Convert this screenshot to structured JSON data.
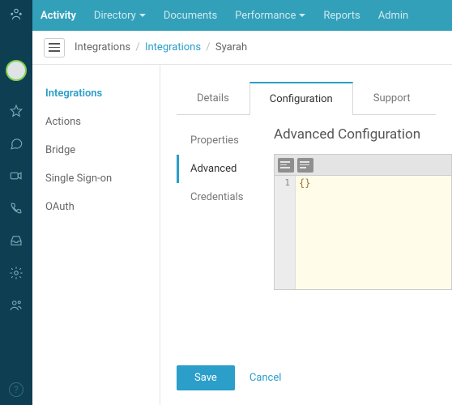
{
  "topnav": {
    "items": [
      {
        "label": "Activity",
        "active": true,
        "caret": false
      },
      {
        "label": "Directory",
        "active": false,
        "caret": true
      },
      {
        "label": "Documents",
        "active": false,
        "caret": false
      },
      {
        "label": "Performance",
        "active": false,
        "caret": true
      },
      {
        "label": "Reports",
        "active": false,
        "caret": false
      },
      {
        "label": "Admin",
        "active": false,
        "caret": false
      }
    ]
  },
  "breadcrumb": {
    "root": "Integrations",
    "link": "Integrations",
    "current": "Syarah"
  },
  "leftmenu": {
    "items": [
      {
        "label": "Integrations",
        "active": true
      },
      {
        "label": "Actions",
        "active": false
      },
      {
        "label": "Bridge",
        "active": false
      },
      {
        "label": "Single Sign-on",
        "active": false
      },
      {
        "label": "OAuth",
        "active": false
      }
    ]
  },
  "tabs": {
    "items": [
      {
        "label": "Details",
        "active": false
      },
      {
        "label": "Configuration",
        "active": true
      },
      {
        "label": "Support",
        "active": false
      }
    ]
  },
  "subtabs": {
    "items": [
      {
        "label": "Properties",
        "active": false
      },
      {
        "label": "Advanced",
        "active": true
      },
      {
        "label": "Credentials",
        "active": false
      }
    ]
  },
  "pane": {
    "title": "Advanced Configuration"
  },
  "editor": {
    "line_number": "1",
    "content": "{}"
  },
  "footer": {
    "save": "Save",
    "cancel": "Cancel"
  },
  "rail": {
    "help": "?"
  }
}
